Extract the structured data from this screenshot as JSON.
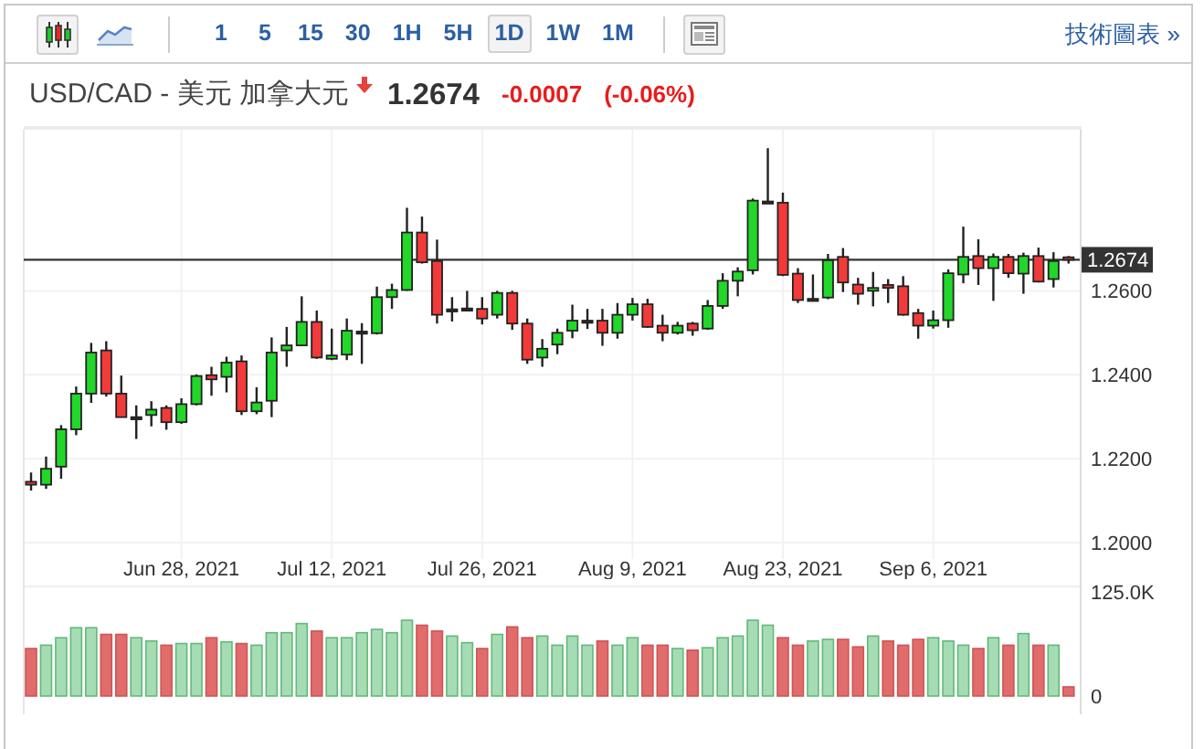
{
  "toolbar": {
    "chart_types": [
      {
        "kind": "candles",
        "selected": true
      },
      {
        "kind": "area",
        "selected": false
      }
    ],
    "intervals": [
      {
        "label": "1",
        "selected": false
      },
      {
        "label": "5",
        "selected": false
      },
      {
        "label": "15",
        "selected": false
      },
      {
        "label": "30",
        "selected": false
      },
      {
        "label": "1H",
        "selected": false
      },
      {
        "label": "5H",
        "selected": false
      },
      {
        "label": "1D",
        "selected": true
      },
      {
        "label": "1W",
        "selected": false
      },
      {
        "label": "1M",
        "selected": false
      }
    ],
    "link": "技術圖表 »"
  },
  "header": {
    "symbol": "USD/CAD - 美元 加拿大元",
    "falling": true,
    "price": "1.2674",
    "change": "-0.0007",
    "change_percent": "(-0.06%)"
  },
  "price_chart": {
    "chart_data": {
      "type": "candlestick",
      "categories": [
        null,
        null,
        null,
        null,
        null,
        null,
        null,
        null,
        null,
        null,
        "Jun 28, 2021",
        null,
        null,
        null,
        null,
        null,
        null,
        null,
        null,
        null,
        "Jul 12, 2021",
        null,
        null,
        null,
        null,
        null,
        null,
        null,
        null,
        null,
        "Jul 26, 2021",
        null,
        null,
        null,
        null,
        null,
        null,
        null,
        null,
        null,
        "Aug 9, 2021",
        null,
        null,
        null,
        null,
        null,
        null,
        null,
        null,
        null,
        "Aug 23, 2021",
        null,
        null,
        null,
        null,
        null,
        null,
        null,
        null,
        null,
        "Sep 6, 2021",
        null,
        null,
        null,
        null,
        null,
        null,
        null,
        null,
        null
      ],
      "yticks": [
        {
          "value": 1.2,
          "label": "1.2000"
        },
        {
          "value": 1.22,
          "label": "1.2200"
        },
        {
          "value": 1.24,
          "label": "1.2400"
        },
        {
          "value": 1.26,
          "label": "1.2600"
        }
      ],
      "ylim": [
        1.1913,
        1.2984
      ],
      "grid": true,
      "ref_lines": [
        {
          "axis": "y",
          "value": 1.2674,
          "label": "1.2674"
        }
      ],
      "ohlc": [
        [
          1.2145,
          1.2167,
          1.2124,
          1.2138
        ],
        [
          1.2138,
          1.2205,
          1.2128,
          1.2176
        ],
        [
          1.2181,
          1.228,
          1.2152,
          1.227
        ],
        [
          1.227,
          1.2372,
          1.2256,
          1.2355
        ],
        [
          1.2355,
          1.2476,
          1.2333,
          1.2453
        ],
        [
          1.2458,
          1.248,
          1.2348,
          1.2355
        ],
        [
          1.2355,
          1.2398,
          1.2299,
          1.2299
        ],
        [
          1.2299,
          1.2327,
          1.2247,
          1.2299
        ],
        [
          1.2304,
          1.2337,
          1.2277,
          1.2317
        ],
        [
          1.2321,
          1.2327,
          1.2269,
          1.2287
        ],
        [
          1.2287,
          1.2344,
          1.2283,
          1.233
        ],
        [
          1.233,
          1.2401,
          1.2327,
          1.2397
        ],
        [
          1.2399,
          1.2419,
          1.235,
          1.2389
        ],
        [
          1.2395,
          1.2443,
          1.2358,
          1.2429
        ],
        [
          1.2432,
          1.2446,
          1.2304,
          1.2313
        ],
        [
          1.2313,
          1.237,
          1.2306,
          1.2334
        ],
        [
          1.2338,
          1.2489,
          1.2299,
          1.2453
        ],
        [
          1.2458,
          1.2514,
          1.2419,
          1.247
        ],
        [
          1.247,
          1.2587,
          1.2469,
          1.2526
        ],
        [
          1.2526,
          1.2553,
          1.2438,
          1.2441
        ],
        [
          1.2438,
          1.251,
          1.2435,
          1.2446
        ],
        [
          1.2448,
          1.2534,
          1.2435,
          1.2505
        ],
        [
          1.2503,
          1.2523,
          1.2426,
          1.2503
        ],
        [
          1.2499,
          1.261,
          1.2496,
          1.2585
        ],
        [
          1.2585,
          1.2617,
          1.2557,
          1.2602
        ],
        [
          1.2602,
          1.2798,
          1.26,
          1.2739
        ],
        [
          1.2739,
          1.2777,
          1.2665,
          1.2668
        ],
        [
          1.2671,
          1.2722,
          1.2522,
          1.2543
        ],
        [
          1.2556,
          1.2585,
          1.2527,
          1.2556
        ],
        [
          1.2558,
          1.26,
          1.2551,
          1.2558
        ],
        [
          1.2557,
          1.2585,
          1.252,
          1.2534
        ],
        [
          1.2543,
          1.26,
          1.2534,
          1.2595
        ],
        [
          1.2595,
          1.26,
          1.2507,
          1.2522
        ],
        [
          1.2522,
          1.2534,
          1.2426,
          1.2436
        ],
        [
          1.2441,
          1.2485,
          1.2419,
          1.2462
        ],
        [
          1.2472,
          1.251,
          1.2449,
          1.25
        ],
        [
          1.2505,
          1.2567,
          1.2487,
          1.2529
        ],
        [
          1.2529,
          1.2557,
          1.2509,
          1.2529
        ],
        [
          1.2529,
          1.2557,
          1.2469,
          1.25
        ],
        [
          1.25,
          1.2571,
          1.2486,
          1.2543
        ],
        [
          1.2543,
          1.2583,
          1.2529,
          1.2568
        ],
        [
          1.2568,
          1.2581,
          1.2512,
          1.2514
        ],
        [
          1.2517,
          1.2543,
          1.248,
          1.25
        ],
        [
          1.25,
          1.2526,
          1.2496,
          1.2517
        ],
        [
          1.2522,
          1.2526,
          1.2493,
          1.2506
        ],
        [
          1.251,
          1.2578,
          1.2507,
          1.2564
        ],
        [
          1.2564,
          1.2642,
          1.2557,
          1.2624
        ],
        [
          1.2624,
          1.2656,
          1.2587,
          1.2646
        ],
        [
          1.2649,
          1.282,
          1.2639,
          1.2815
        ],
        [
          1.2813,
          1.294,
          1.2808,
          1.2813
        ],
        [
          1.281,
          1.2834,
          1.2635,
          1.2638
        ],
        [
          1.2641,
          1.2654,
          1.2571,
          1.2578
        ],
        [
          1.2581,
          1.2639,
          1.2581,
          1.2581
        ],
        [
          1.2584,
          1.2688,
          1.258,
          1.2673
        ],
        [
          1.2681,
          1.2702,
          1.2597,
          1.262
        ],
        [
          1.2615,
          1.2631,
          1.2567,
          1.2593
        ],
        [
          1.26,
          1.2645,
          1.2563,
          1.2607
        ],
        [
          1.2614,
          1.2628,
          1.2571,
          1.2607
        ],
        [
          1.2611,
          1.2635,
          1.2541,
          1.2543
        ],
        [
          1.2547,
          1.2557,
          1.2486,
          1.2517
        ],
        [
          1.2517,
          1.2553,
          1.251,
          1.253
        ],
        [
          1.253,
          1.2651,
          1.2512,
          1.2642
        ],
        [
          1.2639,
          1.2753,
          1.2618,
          1.2681
        ],
        [
          1.2683,
          1.2723,
          1.2614,
          1.2654
        ],
        [
          1.2654,
          1.2689,
          1.2576,
          1.2681
        ],
        [
          1.2681,
          1.2688,
          1.2631,
          1.2642
        ],
        [
          1.2641,
          1.2691,
          1.2593,
          1.2683
        ],
        [
          1.2683,
          1.2703,
          1.262,
          1.2622
        ],
        [
          1.2628,
          1.2692,
          1.2608,
          1.2671
        ],
        [
          1.268,
          1.2683,
          1.2665,
          1.2674
        ]
      ]
    }
  },
  "volume_chart": {
    "chart_data": {
      "type": "bar",
      "categories": [
        null,
        null,
        null,
        null,
        null,
        null,
        null,
        null,
        null,
        null,
        null,
        null,
        null,
        null,
        null,
        null,
        null,
        null,
        null,
        null,
        null,
        null,
        null,
        null,
        null,
        null,
        null,
        null,
        null,
        null,
        null,
        null,
        null,
        null,
        null,
        null,
        null,
        null,
        null,
        null,
        null,
        null,
        null,
        null,
        null,
        null,
        null,
        null,
        null,
        null,
        null,
        null,
        null,
        null,
        null,
        null,
        null,
        null,
        null,
        null,
        null,
        null,
        null,
        null,
        null,
        null,
        null,
        null,
        null,
        null
      ],
      "ylim": [
        0,
        125
      ],
      "yticks": [
        {
          "value": 0,
          "label": "0"
        },
        {
          "value": 125,
          "label": "125.0K"
        }
      ],
      "series": [
        {
          "values": [
            57,
            61,
            70,
            82,
            82,
            74,
            74,
            70,
            66,
            61,
            63,
            63,
            70,
            65,
            63,
            61,
            76,
            76,
            87,
            78,
            70,
            70,
            76,
            80,
            76,
            91,
            85,
            78,
            72,
            64,
            57,
            74,
            83,
            70,
            72,
            61,
            72,
            61,
            66,
            61,
            70,
            61,
            61,
            57,
            55,
            58,
            70,
            72,
            91,
            85,
            70,
            61,
            66,
            68,
            68,
            59,
            72,
            66,
            61,
            68,
            70,
            66,
            61,
            57,
            70,
            61,
            75,
            61,
            61,
            11
          ]
        }
      ]
    }
  }
}
